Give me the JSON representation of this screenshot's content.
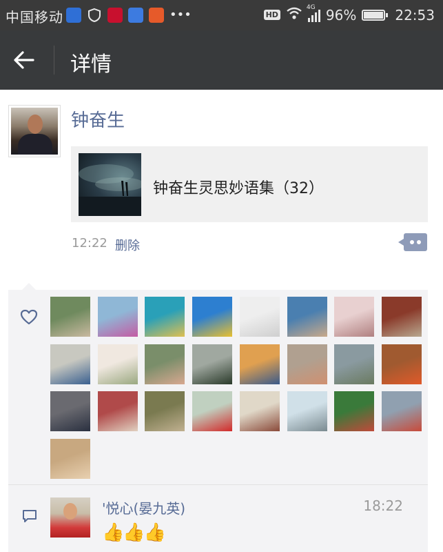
{
  "status_bar": {
    "carrier": "中国移动",
    "hd": "HD",
    "network": "4G",
    "battery": "96%",
    "time": "22:53",
    "app_icon_colors": [
      "#2f6fd6",
      "#e8e8e8",
      "#c8102e",
      "#3d7be0",
      "#e65a2a"
    ]
  },
  "nav": {
    "back_icon": "arrow-left-icon",
    "title": "详情"
  },
  "post": {
    "author": "钟奋生",
    "link_title": "钟奋生灵思妙语集（32）",
    "time": "12:22",
    "delete_label": "删除"
  },
  "likes": {
    "icon": "heart-outline-icon",
    "avatar_colors": [
      [
        "#6f8a5e",
        "#c9b9a0"
      ],
      [
        "#8fb7d6",
        "#c45ba3"
      ],
      [
        "#2aa0b8",
        "#e0c050"
      ],
      [
        "#2d7fd0",
        "#e8c030"
      ],
      [
        "#eeeeee",
        "#cfcfcf"
      ],
      [
        "#4a7fb0",
        "#c9a98a"
      ],
      [
        "#e8d0d0",
        "#b08080"
      ],
      [
        "#8a3a2a",
        "#b8a890"
      ],
      [
        "#c8c8c0",
        "#3a6090"
      ],
      [
        "#f0e8e0",
        "#9aa880"
      ],
      [
        "#7a8e6a",
        "#d8a890"
      ],
      [
        "#a0a8a0",
        "#2a3a2a"
      ],
      [
        "#e0a050",
        "#3a5a8a"
      ],
      [
        "#b0a090",
        "#d09070"
      ],
      [
        "#8a9aa0",
        "#6a7a60"
      ],
      [
        "#a05a30",
        "#e05a2a"
      ],
      [
        "#6a6a70",
        "#2a3040"
      ],
      [
        "#b04a4a",
        "#e0d0c0"
      ],
      [
        "#7a7a50",
        "#c0b090"
      ],
      [
        "#c0d0c0",
        "#d22a2a"
      ],
      [
        "#e0d8c8",
        "#8a4a3a"
      ],
      [
        "#d0e0e8",
        "#7a8a90"
      ],
      [
        "#3a7a3a",
        "#c04a3a"
      ],
      [
        "#90a0b0",
        "#c84a3a"
      ],
      [
        "#c8a880",
        "#e8d0b0"
      ]
    ]
  },
  "comment": {
    "icon": "comment-bubble-icon",
    "name": "'悦心(晏九英)",
    "time": "18:22",
    "text": "👍👍👍"
  }
}
